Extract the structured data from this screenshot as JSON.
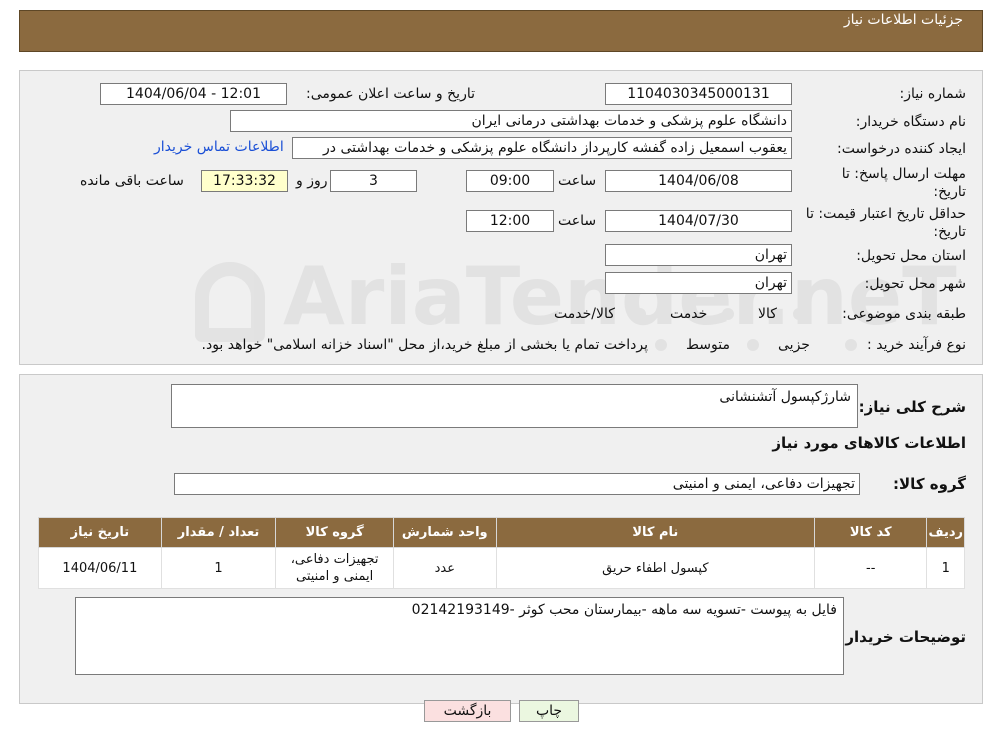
{
  "header": {
    "title": "جزئیات اطلاعات نیاز"
  },
  "watermark": {
    "text": "AriaTender.neT"
  },
  "form": {
    "need_number_label": "شماره نیاز:",
    "need_number": "1104030345000131",
    "announce_label": "تاریخ و ساعت اعلان عمومی:",
    "announce_value": "1404/06/04 - 12:01",
    "buyer_org_label": "نام دستگاه خریدار:",
    "buyer_org": "دانشگاه علوم پزشکی و خدمات بهداشتی درمانی ایران",
    "requester_label": "ایجاد کننده درخواست:",
    "requester": "یعقوب اسمعیل زاده گفشه کارپرداز دانشگاه علوم پزشکی و خدمات بهداشتی در",
    "contact_link": "اطلاعات تماس خریدار",
    "deadline_label": "مهلت ارسال پاسخ: تا تاریخ:",
    "deadline_date": "1404/06/08",
    "time_label": "ساعت",
    "deadline_time": "09:00",
    "days_count": "3",
    "days_and_label": "روز و",
    "remaining_time": "17:33:32",
    "remaining_label": "ساعت باقی مانده",
    "validity_label": "حداقل تاریخ اعتبار قیمت: تا تاریخ:",
    "validity_date": "1404/07/30",
    "validity_time": "12:00",
    "province_label": "استان محل تحویل:",
    "province": "تهران",
    "city_label": "شهر محل تحویل:",
    "city": "تهران",
    "category_label": "طبقه بندی موضوعی:",
    "category_options": [
      "کالا",
      "خدمت",
      "کالا/خدمت"
    ],
    "purchase_type_label": "نوع فرآیند خرید :",
    "purchase_options": [
      "جزیی",
      "متوسط"
    ],
    "purchase_note": "پرداخت تمام یا بخشی از مبلغ خرید،از محل \"اسناد خزانه اسلامی\" خواهد بود."
  },
  "summary": {
    "description_label": "شرح کلی نیاز:",
    "description": "شارژکپسول آتشنشانی",
    "goods_info_title": "اطلاعات کالاهای مورد نیاز",
    "goods_group_label": "گروه کالا:",
    "goods_group": "تجهیزات دفاعی، ایمنی و امنیتی"
  },
  "table": {
    "headers": [
      "ردیف",
      "کد کالا",
      "نام کالا",
      "واحد شمارش",
      "گروه کالا",
      "تعداد / مقدار",
      "تاریخ نیاز"
    ],
    "rows": [
      [
        "1",
        "--",
        "کپسول اطفاء حریق",
        "عدد",
        "تجهیزات دفاعی، ایمنی و امنیتی",
        "1",
        "1404/06/11"
      ]
    ]
  },
  "buyer_notes": {
    "label": "توضیحات خریدار:",
    "text": "فایل به پیوست -تسویه سه ماهه -بیمارستان محب کوثر -02142193149"
  },
  "buttons": {
    "print": "چاپ",
    "back": "بازگشت"
  }
}
